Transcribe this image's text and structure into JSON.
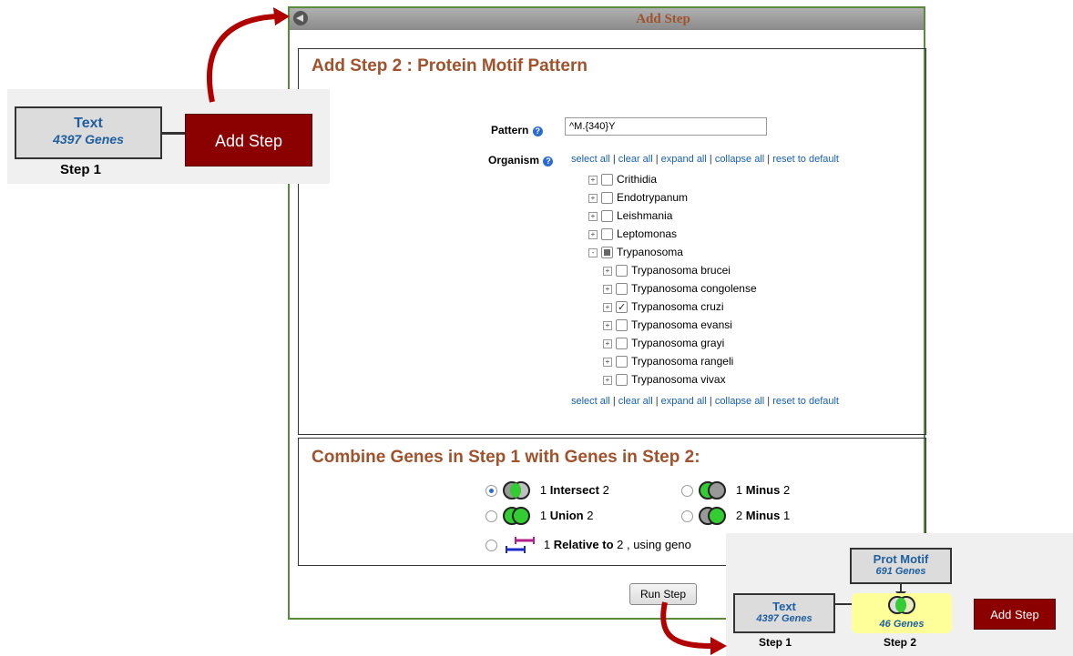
{
  "dialog": {
    "title": "Add Step",
    "section1_title": "Add Step 2 : Protein Motif Pattern",
    "pattern_label": "Pattern",
    "pattern_value": "^M.{340}Y",
    "organism_label": "Organism",
    "links": {
      "select_all": "select all",
      "clear_all": "clear all",
      "expand_all": "expand all",
      "collapse_all": "collapse all",
      "reset": "reset to default",
      "sep": "|"
    },
    "tree": [
      {
        "label": "Crithidia",
        "expander": "+",
        "state": "unchecked"
      },
      {
        "label": "Endotrypanum",
        "expander": "+",
        "state": "unchecked"
      },
      {
        "label": "Leishmania",
        "expander": "+",
        "state": "unchecked"
      },
      {
        "label": "Leptomonas",
        "expander": "+",
        "state": "unchecked"
      },
      {
        "label": "Trypanosoma",
        "expander": "-",
        "state": "partial"
      },
      {
        "label": "Trypanosoma brucei",
        "expander": "+",
        "state": "unchecked"
      },
      {
        "label": "Trypanosoma congolense",
        "expander": "+",
        "state": "unchecked"
      },
      {
        "label": "Trypanosoma cruzi",
        "expander": "+",
        "state": "checked"
      },
      {
        "label": "Trypanosoma evansi",
        "expander": "+",
        "state": "unchecked"
      },
      {
        "label": "Trypanosoma grayi",
        "expander": "+",
        "state": "unchecked"
      },
      {
        "label": "Trypanosoma rangeli",
        "expander": "+",
        "state": "unchecked"
      },
      {
        "label": "Trypanosoma vivax",
        "expander": "+",
        "state": "unchecked"
      }
    ],
    "section2_title": "Combine Genes in Step 1 with Genes in Step 2:",
    "ops": {
      "intersect": {
        "pre": "1",
        "word": "Intersect",
        "post": "2"
      },
      "minus12": {
        "pre": "1",
        "word": "Minus",
        "post": "2"
      },
      "union": {
        "pre": "1",
        "word": "Union",
        "post": "2"
      },
      "minus21": {
        "pre": "2",
        "word": "Minus",
        "post": "1"
      },
      "relative": {
        "pre": "1",
        "word": "Relative to",
        "post": "2 , using geno"
      }
    },
    "run_label": "Run Step"
  },
  "left_callout": {
    "step_name": "Text",
    "step_count": "4397 Genes",
    "step_label": "Step 1",
    "add_step": "Add Step"
  },
  "right_callout": {
    "step1_name": "Text",
    "step1_count": "4397 Genes",
    "step1_label": "Step 1",
    "motif_name": "Prot Motif",
    "motif_count": "691 Genes",
    "result_count": "46 Genes",
    "step2_label": "Step 2",
    "add_step": "Add Step"
  },
  "colors": {
    "title": "#a0522d",
    "link": "#1a5fb4",
    "arrow": "#b00000",
    "add_step_btn": "#8b0000",
    "venn_green": "#33cc33",
    "dialog_border": "#5a8a3c"
  }
}
